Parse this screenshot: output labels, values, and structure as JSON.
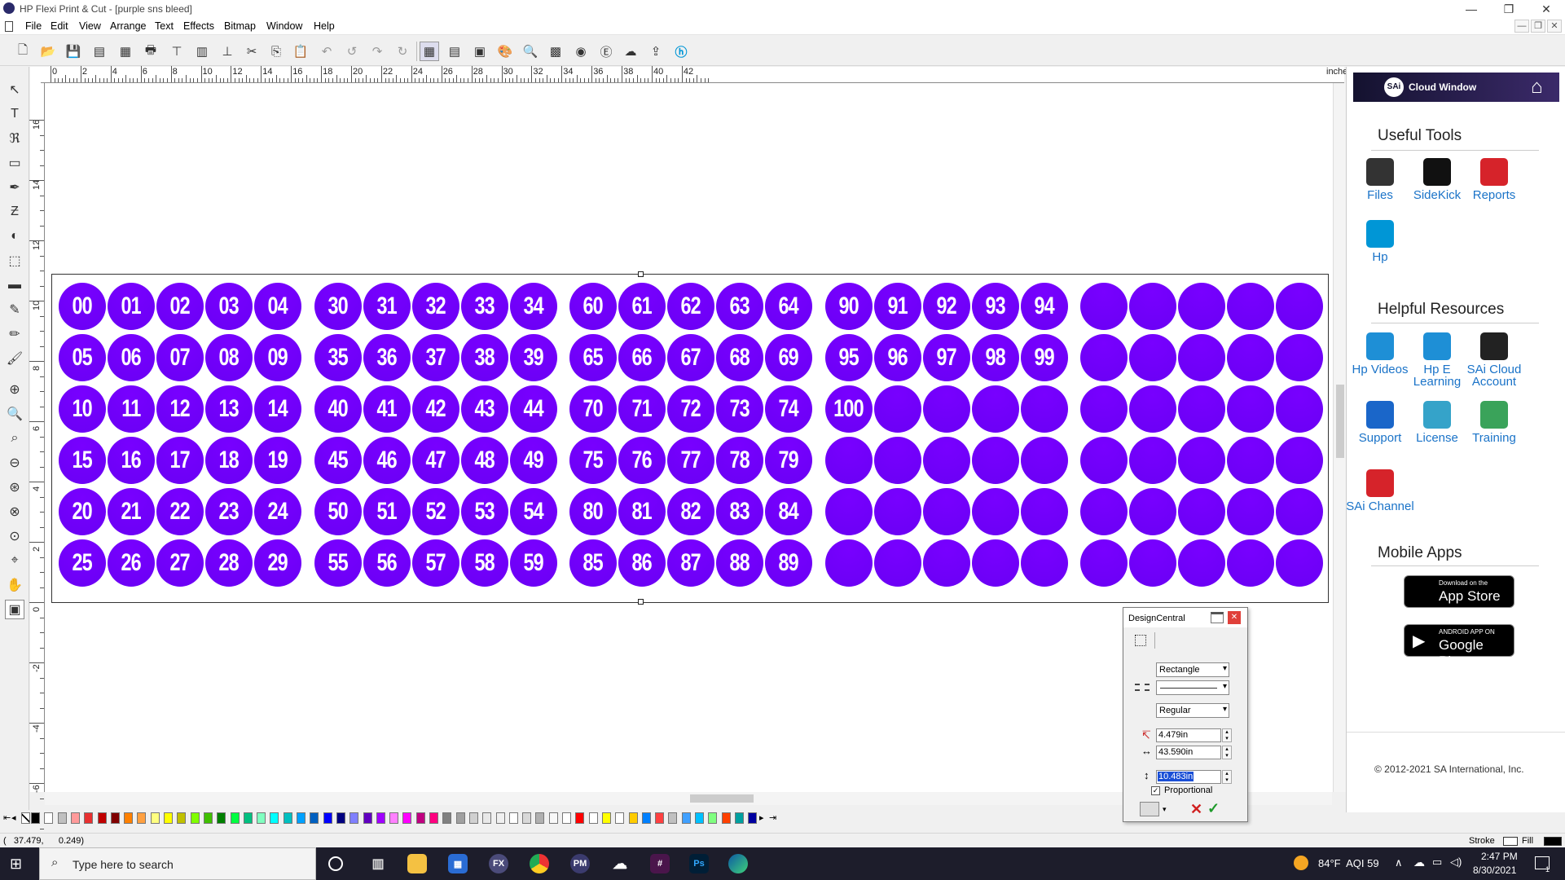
{
  "window": {
    "title": "HP Flexi Print & Cut - [purple sns bleed]",
    "minimize_glyph": "—",
    "restore_glyph": "❐",
    "close_glyph": "✕"
  },
  "menu": [
    "File",
    "Edit",
    "View",
    "Arrange",
    "Text",
    "Effects",
    "Bitmap",
    "Window",
    "Help"
  ],
  "ruler": {
    "unit": "inches",
    "top_labels": [
      "0",
      "2",
      "4",
      "6",
      "8",
      "10",
      "12",
      "14",
      "16",
      "18",
      "20",
      "22",
      "24",
      "26",
      "28",
      "30",
      "32",
      "34",
      "36",
      "38",
      "40",
      "42"
    ],
    "left_labels": [
      "16",
      "14",
      "12",
      "10",
      "8",
      "6",
      "4",
      "2",
      "0",
      "-2",
      "-4",
      "-6"
    ]
  },
  "design": {
    "fill_color": "#6a00f4",
    "groups": [
      {
        "rows": [
          [
            "00",
            "01",
            "02",
            "03",
            "04"
          ],
          [
            "05",
            "06",
            "07",
            "08",
            "09"
          ],
          [
            "10",
            "11",
            "12",
            "13",
            "14"
          ],
          [
            "15",
            "16",
            "17",
            "18",
            "19"
          ],
          [
            "20",
            "21",
            "22",
            "23",
            "24"
          ],
          [
            "25",
            "26",
            "27",
            "28",
            "29"
          ]
        ]
      },
      {
        "rows": [
          [
            "30",
            "31",
            "32",
            "33",
            "34"
          ],
          [
            "35",
            "36",
            "37",
            "38",
            "39"
          ],
          [
            "40",
            "41",
            "42",
            "43",
            "44"
          ],
          [
            "45",
            "46",
            "47",
            "48",
            "49"
          ],
          [
            "50",
            "51",
            "52",
            "53",
            "54"
          ],
          [
            "55",
            "56",
            "57",
            "58",
            "59"
          ]
        ]
      },
      {
        "rows": [
          [
            "60",
            "61",
            "62",
            "63",
            "64"
          ],
          [
            "65",
            "66",
            "67",
            "68",
            "69"
          ],
          [
            "70",
            "71",
            "72",
            "73",
            "74"
          ],
          [
            "75",
            "76",
            "77",
            "78",
            "79"
          ],
          [
            "80",
            "81",
            "82",
            "83",
            "84"
          ],
          [
            "85",
            "86",
            "87",
            "88",
            "89"
          ]
        ]
      },
      {
        "rows": [
          [
            "90",
            "91",
            "92",
            "93",
            "94"
          ],
          [
            "95",
            "96",
            "97",
            "98",
            "99"
          ],
          [
            "100",
            "",
            "",
            "",
            ""
          ],
          [
            "",
            "",
            "",
            "",
            ""
          ],
          [
            "",
            "",
            "",
            "",
            ""
          ],
          [
            "",
            "",
            "",
            "",
            ""
          ]
        ]
      },
      {
        "rows": [
          [
            "",
            "",
            "",
            "",
            ""
          ],
          [
            "",
            "",
            "",
            "",
            ""
          ],
          [
            "",
            "",
            "",
            "",
            ""
          ],
          [
            "",
            "",
            "",
            "",
            ""
          ],
          [
            "",
            "",
            "",
            "",
            ""
          ],
          [
            "",
            "",
            "",
            "",
            ""
          ]
        ]
      }
    ]
  },
  "right_panel": {
    "header": "Cloud Window",
    "useful_tools_title": "Useful Tools",
    "useful_tools": [
      {
        "label": "Files",
        "icon": "files-icon",
        "color": "#333333"
      },
      {
        "label": "SideKick",
        "icon": "sidekick-icon",
        "color": "#111111"
      },
      {
        "label": "Reports",
        "icon": "reports-icon",
        "color": "#d6232a"
      },
      {
        "label": "Hp",
        "icon": "hp-icon",
        "color": "#0096d6"
      }
    ],
    "helpful_title": "Helpful Resources",
    "helpful": [
      {
        "label": "Hp Videos",
        "icon": "video-icon",
        "color": "#1e8fd6"
      },
      {
        "label": "Hp E Learning",
        "icon": "elearning-icon",
        "color": "#1e8fd6"
      },
      {
        "label": "SAi Cloud Account",
        "icon": "cloud-account-icon",
        "color": "#222222"
      },
      {
        "label": "Support",
        "icon": "support-icon",
        "color": "#1a66c9"
      },
      {
        "label": "License",
        "icon": "license-icon",
        "color": "#35a3c9"
      },
      {
        "label": "Training",
        "icon": "training-icon",
        "color": "#3aa35a"
      },
      {
        "label": "SAi Channel",
        "icon": "youtube-icon",
        "color": "#d6232a"
      }
    ],
    "mobile_title": "Mobile Apps",
    "app_store": {
      "small": "Download on the",
      "big": "App Store"
    },
    "google_play": {
      "small": "ANDROID APP ON",
      "big": "Google Play"
    },
    "copyright": "© 2012-2021 SA International, Inc."
  },
  "design_central": {
    "title": "DesignCentral",
    "shape": "Rectangle",
    "line": "",
    "style": "Regular",
    "corner": "4.479in",
    "width": "43.590in",
    "height": "10.483in",
    "proportional_label": "Proportional",
    "proportional_checked": true
  },
  "status": {
    "coords": "(   37.479,      0.249)",
    "stroke_label": "Stroke",
    "fill_label": "Fill"
  },
  "taskbar": {
    "search_placeholder": "Type here to search",
    "weather": "84°F  AQI 59",
    "time": "2:47 PM",
    "date": "8/30/2021",
    "notification_count": "1"
  },
  "palette": [
    "#000000",
    "#ffffff",
    "#c0c0c0",
    "#ff9a9a",
    "#e83030",
    "#c00000",
    "#800000",
    "#ff8000",
    "#ffa040",
    "#ffff80",
    "#ffff00",
    "#c0c000",
    "#80ff00",
    "#40c000",
    "#008000",
    "#00ff40",
    "#00c080",
    "#80ffc0",
    "#00ffff",
    "#00c0c0",
    "#00a0ff",
    "#0060c0",
    "#0000ff",
    "#000080",
    "#8080ff",
    "#6000c0",
    "#a000ff",
    "#ff80ff",
    "#ff00ff",
    "#c00080",
    "#ff0080",
    "#808080",
    "#a0a0a0",
    "#d0d0d0",
    "#e8e8e8",
    "#f0f0f0",
    "#ffffff",
    "#d8d8d8",
    "#b0b0b0",
    "#f8f8f8",
    "#ffffff",
    "#ff0000",
    "#ffffff",
    "#ffff00",
    "#ffffff",
    "#ffcc00",
    "#0080ff",
    "#ff4040",
    "#c0c0c0",
    "#40a0ff",
    "#00c0ff",
    "#80ff80",
    "#ff4000",
    "#00a0a0",
    "#0000a0"
  ]
}
